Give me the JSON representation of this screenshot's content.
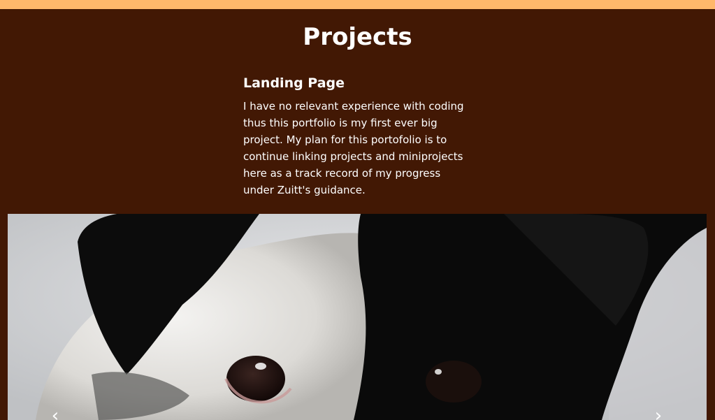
{
  "colors": {
    "accent_bar": "#ffb86b",
    "section_background": "#421804",
    "text": "#ffffff"
  },
  "projects": {
    "heading": "Projects",
    "items": [
      {
        "title": "Landing Page",
        "description": "I have no relevant experience with coding thus this portfolio is my first ever big project. My plan for this portofolio is to continue linking projects and miniprojects here as a track record of my progress under Zuitt's guidance."
      }
    ]
  },
  "carousel": {
    "image": "black-and-white-puppy-photo",
    "prev_icon": "chevron-left-icon",
    "next_icon": "chevron-right-icon",
    "prev_glyph": "‹",
    "next_glyph": "›"
  }
}
